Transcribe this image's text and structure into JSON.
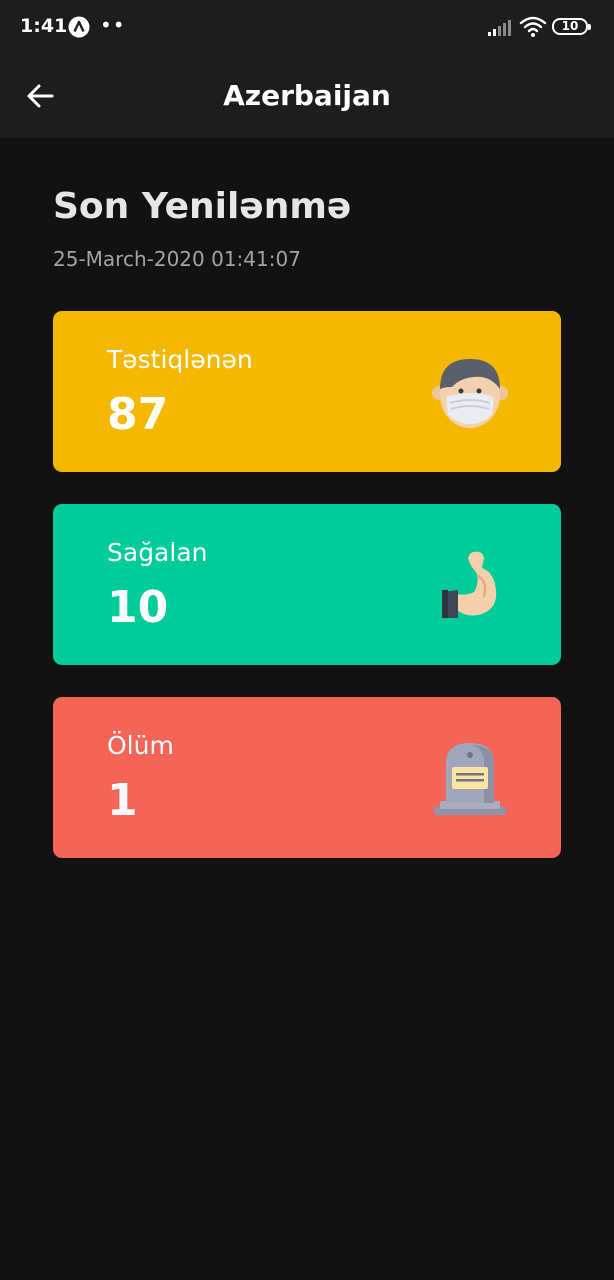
{
  "status_bar": {
    "time": "1:41",
    "dots": "••",
    "battery": "10"
  },
  "app_bar": {
    "title": "Azerbaijan"
  },
  "summary": {
    "title": "Son Yenilənmə",
    "timestamp": "25-March-2020 01:41:07"
  },
  "cards": [
    {
      "label": "Təstiqlənən",
      "value": "87",
      "color": "#F4B800",
      "icon": "masked-person-icon"
    },
    {
      "label": "Sağalan",
      "value": "10",
      "color": "#00CC99",
      "icon": "flexed-arm-icon"
    },
    {
      "label": "Ölüm",
      "value": "1",
      "color": "#F46457",
      "icon": "tombstone-icon"
    }
  ],
  "colors": {
    "background": "#121212",
    "app_bar": "#1D1D1D"
  }
}
